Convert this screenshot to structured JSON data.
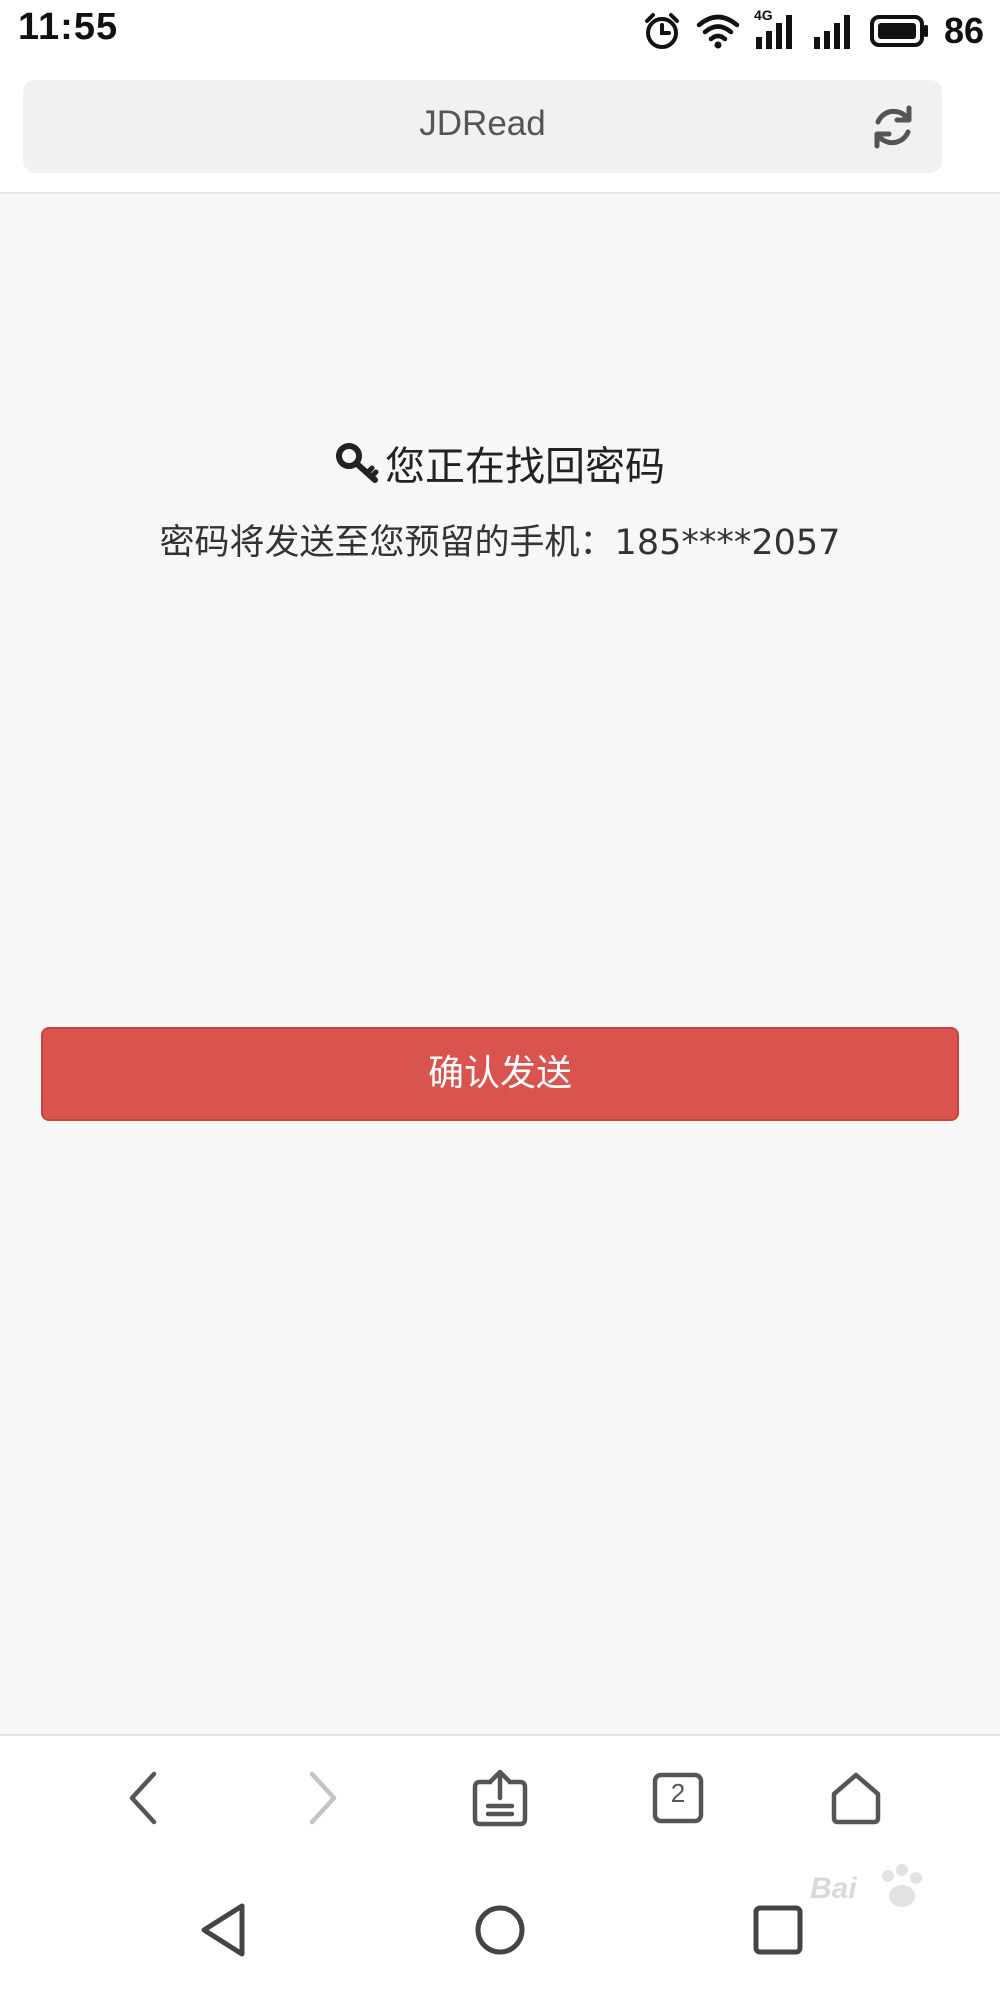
{
  "status_bar": {
    "time": "11:55",
    "network": "4G",
    "battery": "86"
  },
  "browser": {
    "page_title": "JDRead",
    "tabs_count": "2"
  },
  "page": {
    "heading": "您正在找回密码",
    "subtext": "密码将发送至您预留的手机：185****2057",
    "confirm_button": "确认发送",
    "accent_color": "#d9534f"
  },
  "watermark": {
    "logo_text": "Bai"
  },
  "icons": {
    "heading": "key-icon",
    "refresh": "refresh-icon",
    "back": "chevron-left-icon",
    "forward": "chevron-right-icon",
    "share": "share-icon",
    "tabs": "tabs-icon",
    "home": "home-icon",
    "nav_back": "triangle-back-icon",
    "nav_home": "circle-home-icon",
    "nav_recent": "square-recent-icon"
  }
}
